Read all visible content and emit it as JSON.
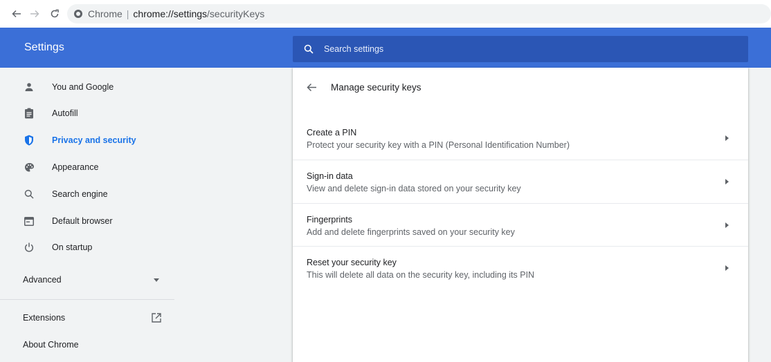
{
  "browser": {
    "omnibox": {
      "origin_label": "Chrome",
      "separator": "|",
      "url_host": "chrome://settings",
      "url_path": "/securityKeys"
    },
    "back_icon": "arrow-left",
    "forward_icon": "arrow-right",
    "reload_icon": "reload"
  },
  "header": {
    "title": "Settings",
    "search_placeholder": "Search settings",
    "bg_color": "#3b6fd7",
    "search_bg_color": "#2b56b5"
  },
  "sidebar": {
    "items": [
      {
        "label": "You and Google",
        "icon": "person-icon"
      },
      {
        "label": "Autofill",
        "icon": "clipboard-icon"
      },
      {
        "label": "Privacy and security",
        "icon": "shield-icon",
        "active": true
      },
      {
        "label": "Appearance",
        "icon": "palette-icon"
      },
      {
        "label": "Search engine",
        "icon": "search-icon"
      },
      {
        "label": "Default browser",
        "icon": "browser-window-icon"
      },
      {
        "label": "On startup",
        "icon": "power-icon"
      }
    ],
    "advanced_label": "Advanced",
    "extensions_label": "Extensions",
    "about_label": "About Chrome",
    "active_color": "#1a73e8"
  },
  "main": {
    "title": "Manage security keys",
    "rows": [
      {
        "title": "Create a PIN",
        "subtitle": "Protect your security key with a PIN (Personal Identification Number)"
      },
      {
        "title": "Sign-in data",
        "subtitle": "View and delete sign-in data stored on your security key"
      },
      {
        "title": "Fingerprints",
        "subtitle": "Add and delete fingerprints saved on your security key"
      },
      {
        "title": "Reset your security key",
        "subtitle": "This will delete all data on the security key, including its PIN"
      }
    ]
  }
}
